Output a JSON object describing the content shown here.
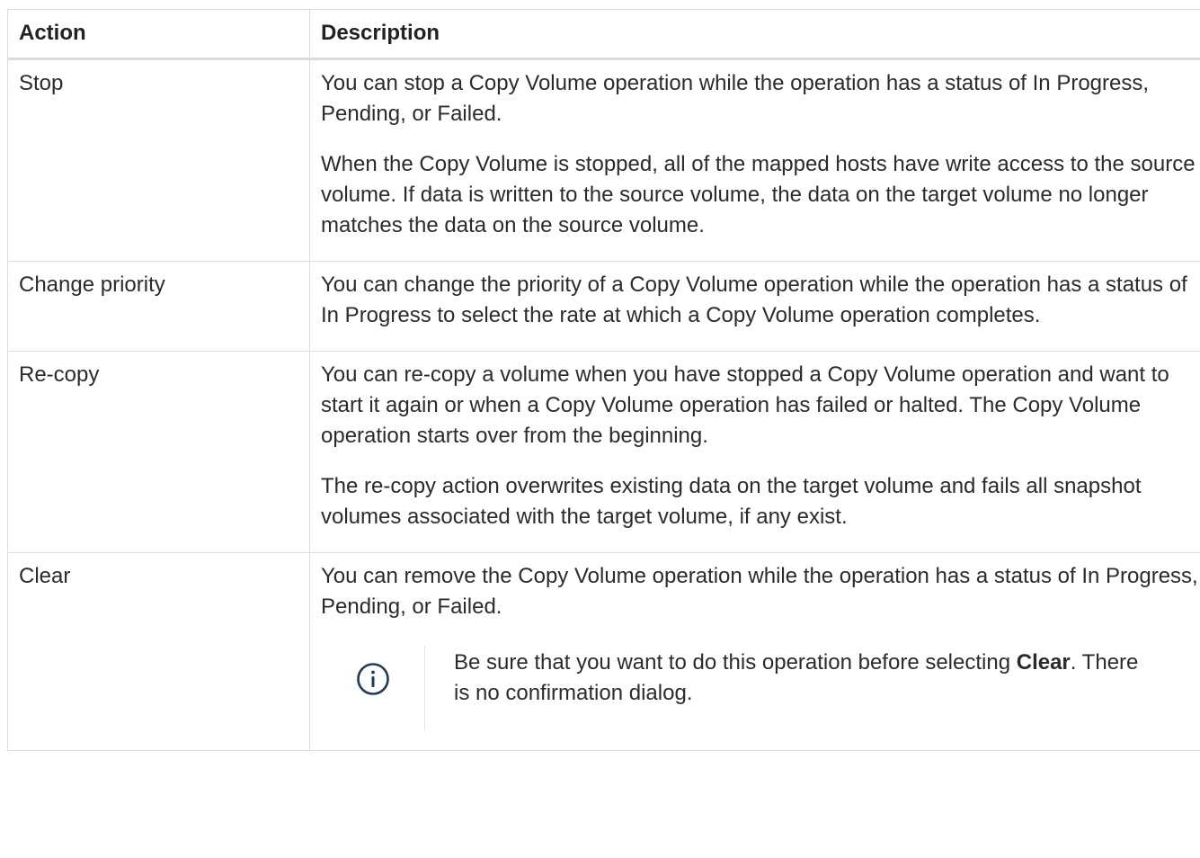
{
  "table": {
    "headers": {
      "action": "Action",
      "description": "Description"
    },
    "rows": [
      {
        "action": "Stop",
        "paragraphs": [
          "You can stop a Copy Volume operation while the operation has a status of In Progress, Pending, or Failed.",
          "When the Copy Volume is stopped, all of the mapped hosts have write access to the source volume. If data is written to the source volume, the data on the target volume no longer matches the data on the source volume."
        ]
      },
      {
        "action": "Change priority",
        "paragraphs": [
          "You can change the priority of a Copy Volume operation while the operation has a status of In Progress to select the rate at which a Copy Volume operation completes."
        ]
      },
      {
        "action": "Re-copy",
        "paragraphs": [
          "You can re-copy a volume when you have stopped a Copy Volume operation and want to start it again or when a Copy Volume operation has failed or halted. The Copy Volume operation starts over from the beginning.",
          "The re-copy action overwrites existing data on the target volume and fails all snapshot volumes associated with the target volume, if any exist."
        ]
      },
      {
        "action": "Clear",
        "paragraphs": [
          "You can remove the Copy Volume operation while the operation has a status of In Progress, Pending, or Failed."
        ],
        "note": {
          "icon": "info-icon",
          "text_before": "Be sure that you want to do this operation before selecting ",
          "bold": "Clear",
          "text_after": ". There is no confirmation dialog."
        }
      }
    ]
  },
  "colors": {
    "text": "#2b2b2b",
    "border": "#dcdcdc",
    "icon": "#1f3a5a"
  }
}
